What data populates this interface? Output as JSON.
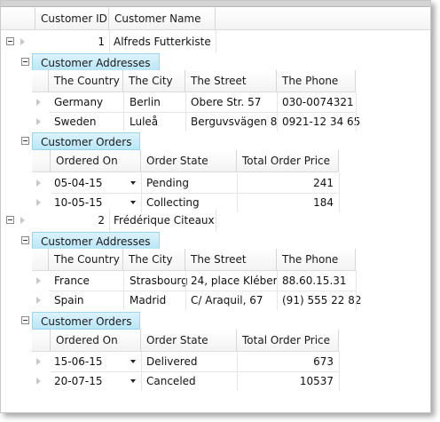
{
  "header": {
    "col_customer_id": "Customer ID",
    "col_customer_name": "Customer Name"
  },
  "customers": [
    {
      "id": "1",
      "name": "Alfreds Futterkiste",
      "addresses_tab": "Customer Addresses",
      "address_columns": [
        "The Country",
        "The City",
        "The Street",
        "The Phone"
      ],
      "addresses": [
        [
          "Germany",
          "Berlin",
          "Obere Str. 57",
          "030-0074321"
        ],
        [
          "Sweden",
          "Luleå",
          "Berguvsvägen  8",
          "0921-12 34 65"
        ]
      ],
      "orders_tab": "Customer Orders",
      "order_columns": [
        "Ordered On",
        "Order State",
        "Total Order Price"
      ],
      "orders": [
        [
          "05-04-15",
          "Pending",
          "241"
        ],
        [
          "10-05-15",
          "Collecting",
          "184"
        ]
      ]
    },
    {
      "id": "2",
      "name": "Frédérique Citeaux",
      "addresses_tab": "Customer Addresses",
      "address_columns": [
        "The Country",
        "The City",
        "The Street",
        "The Phone"
      ],
      "addresses": [
        [
          "France",
          "Strasbourg",
          "24, place Kléber",
          "88.60.15.31"
        ],
        [
          "Spain",
          "Madrid",
          "C/ Araquil, 67",
          "(91) 555 22 82"
        ]
      ],
      "orders_tab": "Customer Orders",
      "order_columns": [
        "Ordered On",
        "Order State",
        "Total Order Price"
      ],
      "orders": [
        [
          "15-06-15",
          "Delivered",
          "673"
        ],
        [
          "20-07-15",
          "Canceled",
          "10537"
        ]
      ]
    }
  ]
}
